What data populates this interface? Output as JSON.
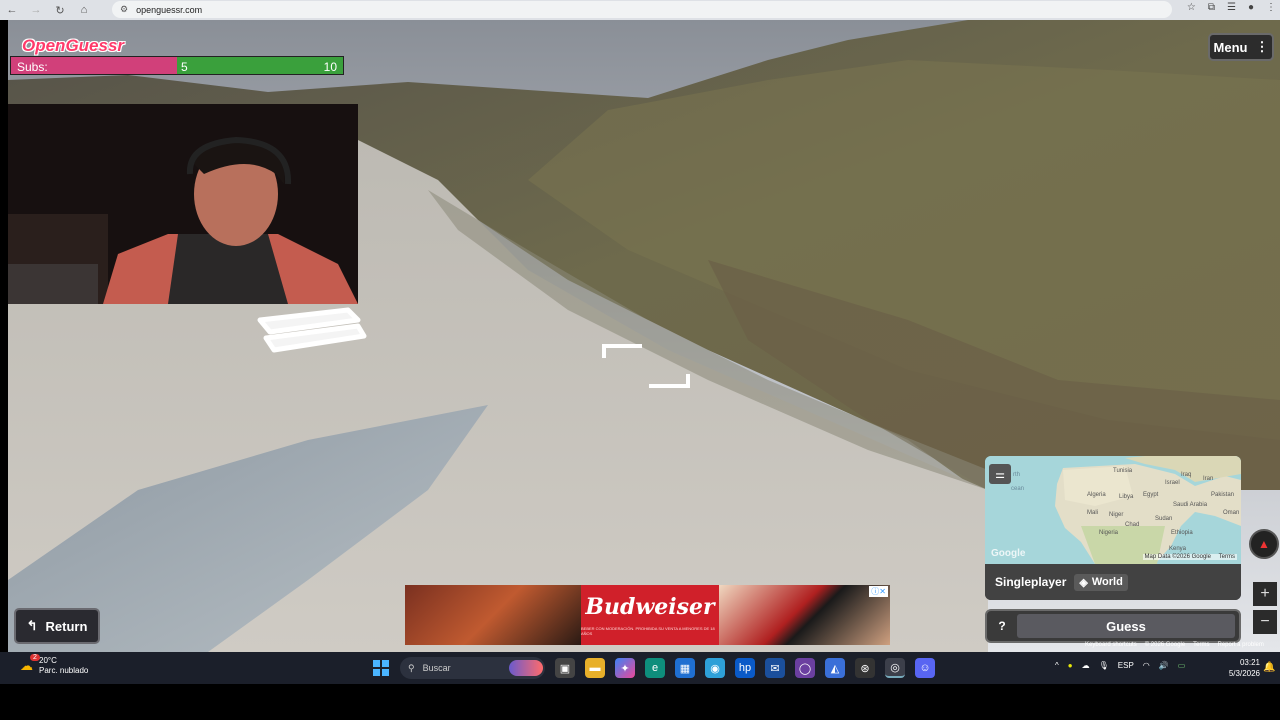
{
  "browser": {
    "url": "openguessr.com",
    "icons": [
      "back-icon",
      "forward-icon",
      "reload-icon",
      "home-icon",
      "site-info-icon",
      "star-icon",
      "extensions-icon",
      "reading-list-icon",
      "profile-icon",
      "more-icon"
    ]
  },
  "overlay": {
    "brand": "OpenGuessr",
    "subs": {
      "label": "Subs:",
      "current": "5",
      "max": "10",
      "progress": 0.5
    }
  },
  "menu": {
    "label": "Menu"
  },
  "return_button": {
    "label": "Return"
  },
  "ad": {
    "brand": "Budweiser",
    "fine_print": "BEBER CON MODERACIÓN. PROHIBIDA SU VENTA A MENORES DE 18 AÑOS"
  },
  "map": {
    "mode": "Singleplayer",
    "region": "World",
    "labels": [
      "Tunisia",
      "Algeria",
      "Libya",
      "Egypt",
      "Israel",
      "Iraq",
      "Iran",
      "Pakistan",
      "Saudi Arabia",
      "Mali",
      "Niger",
      "Chad",
      "Sudan",
      "Nigeria",
      "Ethiopia",
      "Kenya",
      "Oman"
    ],
    "partial_labels": [
      "rth",
      "cean"
    ],
    "google": "Google",
    "attribution": "Map Data ©2026 Google",
    "terms": "Terms"
  },
  "guess": {
    "help": "?",
    "label": "Guess"
  },
  "zoom": {
    "in": "+",
    "out": "−"
  },
  "streetview_footer": [
    "Keyboard shortcuts",
    "© 2026 Google",
    "Terms",
    "Report a problem"
  ],
  "taskbar": {
    "weather_temp": "20°C",
    "weather_desc": "Parc. nublado",
    "weather_badge": "2",
    "search_placeholder": "Buscar",
    "lang": "ESP",
    "time": "03:21",
    "date": "5/3/2026"
  }
}
